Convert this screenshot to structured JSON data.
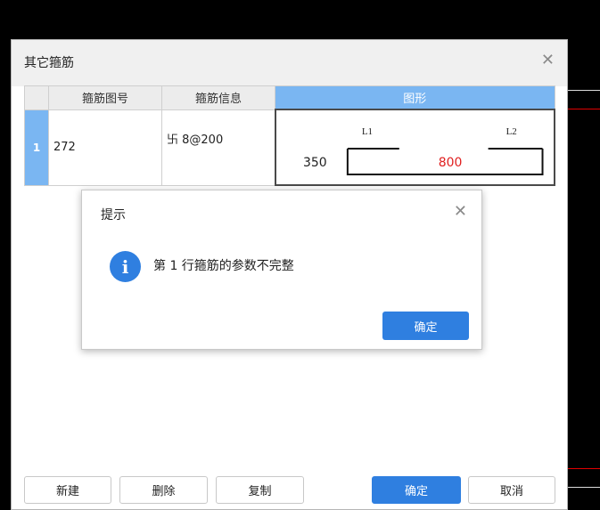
{
  "dialog": {
    "title": "其它箍筋",
    "close_icon": "close-icon"
  },
  "table": {
    "headers": [
      "",
      "箍筋图号",
      "箍筋信息",
      "图形"
    ],
    "rows": [
      {
        "index": "1",
        "code": "272",
        "info": "卐 8@200",
        "shape": {
          "l1": "L1",
          "l2": "L2",
          "left_value": "350",
          "main_value": "800"
        }
      }
    ]
  },
  "buttons": {
    "new": "新建",
    "delete": "删除",
    "copy": "复制",
    "ok": "确定",
    "cancel": "取消"
  },
  "message_box": {
    "title": "提示",
    "text": "第 1 行箍筋的参数不完整",
    "ok": "确定",
    "icon": "info-icon"
  },
  "colors": {
    "accent": "#2f7fe0",
    "header_highlight": "#7ab6f2",
    "dim_value_red": "#e02020",
    "cad_line_red": "#e00000"
  }
}
